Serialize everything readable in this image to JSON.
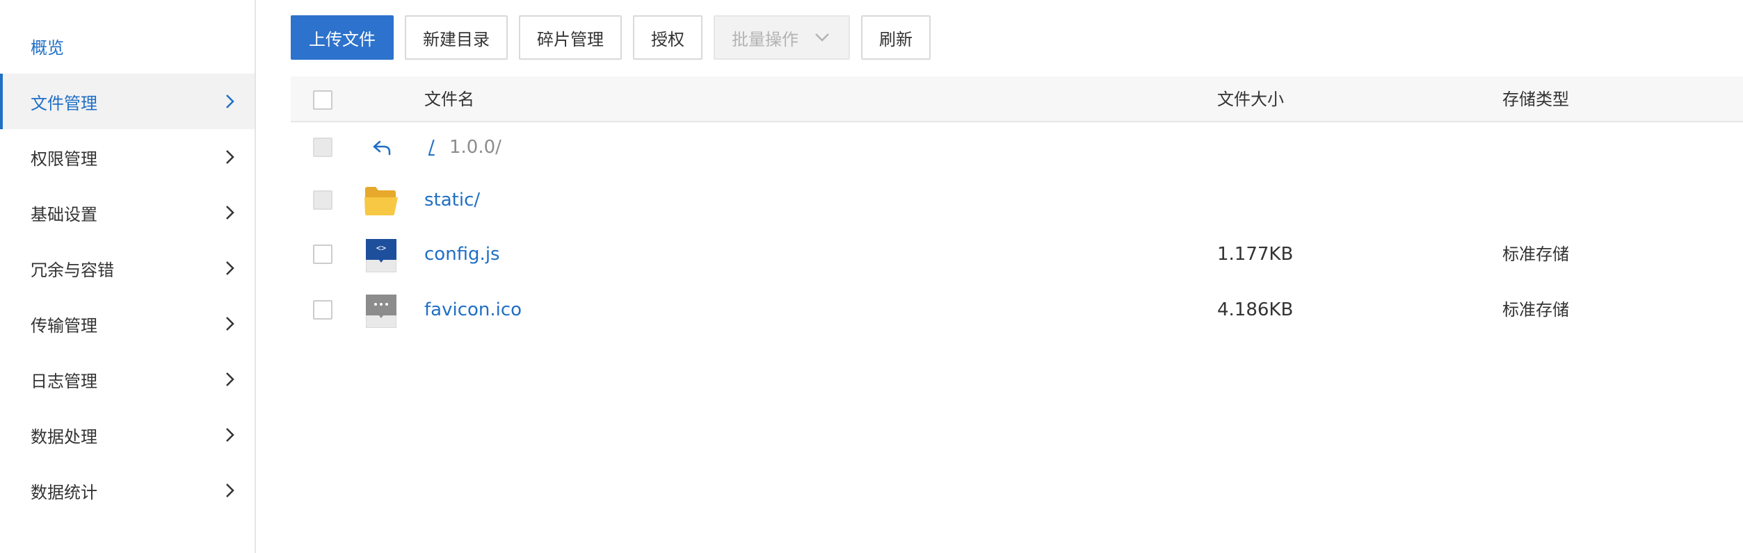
{
  "sidebar": {
    "items": [
      {
        "label": "概览"
      },
      {
        "label": "文件管理"
      },
      {
        "label": "权限管理"
      },
      {
        "label": "基础设置"
      },
      {
        "label": "冗余与容错"
      },
      {
        "label": "传输管理"
      },
      {
        "label": "日志管理"
      },
      {
        "label": "数据处理"
      },
      {
        "label": "数据统计"
      }
    ]
  },
  "toolbar": {
    "upload_label": "上传文件",
    "new_dir_label": "新建目录",
    "fragment_label": "碎片管理",
    "authorize_label": "授权",
    "batch_label": "批量操作",
    "refresh_label": "刷新"
  },
  "table": {
    "columns": {
      "name": "文件名",
      "size": "文件大小",
      "storage": "存储类型"
    },
    "breadcrumb": {
      "root": "/",
      "path": "1.0.0/"
    },
    "rows": [
      {
        "name": "static/",
        "size": "",
        "storage": ""
      },
      {
        "name": "config.js",
        "size": "1.177KB",
        "storage": "标准存储"
      },
      {
        "name": "favicon.ico",
        "size": "4.186KB",
        "storage": "标准存储"
      }
    ]
  },
  "colors": {
    "accent": "#2d72cc",
    "link": "#1f6fc5",
    "folder": "#f7c843"
  },
  "icons": {
    "back": "back-arrow-icon",
    "folder": "folder-icon",
    "code_file": "code-file-icon",
    "generic_file": "generic-file-icon",
    "chevron": "chevron-right-icon",
    "caret": "chevron-down-icon"
  }
}
